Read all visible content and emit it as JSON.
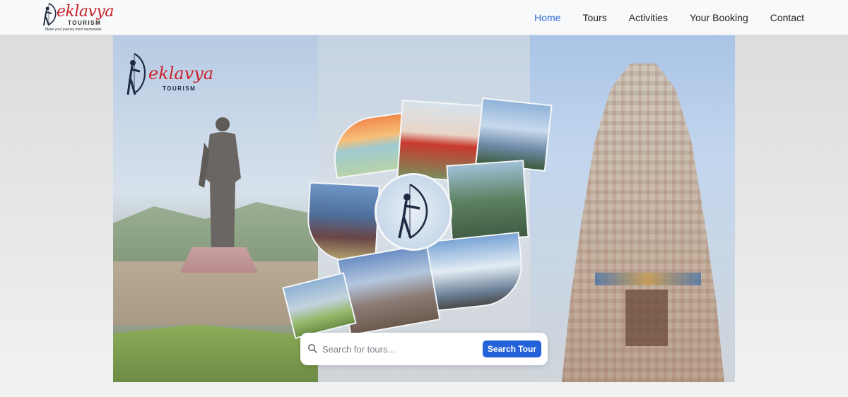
{
  "brand": {
    "name": "eklavya",
    "sub": "TOURISM",
    "tagline": "Make your journey most memorable",
    "accent": "#c8232c",
    "logo_icon": "archer-icon"
  },
  "nav": {
    "items": [
      {
        "label": "Home",
        "active": true
      },
      {
        "label": "Tours",
        "active": false
      },
      {
        "label": "Activities",
        "active": false
      },
      {
        "label": "Your Booking",
        "active": false
      },
      {
        "label": "Contact",
        "active": false
      }
    ],
    "active_color": "#2f6bd8"
  },
  "hero": {
    "logo_word": "eklavya",
    "logo_sub": "TOURISM"
  },
  "search": {
    "placeholder": "Search for tours...",
    "value": "",
    "button_label": "Search Tour",
    "button_color": "#2462d9",
    "icon": "search-icon"
  }
}
